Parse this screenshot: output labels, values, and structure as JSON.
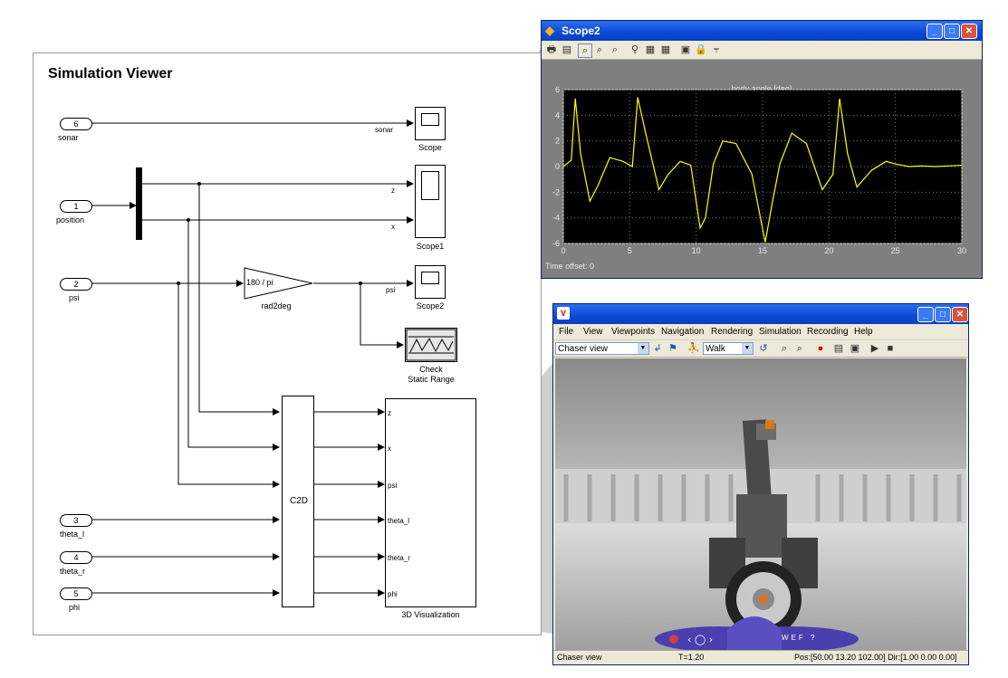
{
  "diagram": {
    "title": "Simulation Viewer",
    "inports": [
      {
        "num": "6",
        "name": "sonar"
      },
      {
        "num": "1",
        "name": "position"
      },
      {
        "num": "2",
        "name": "psi"
      },
      {
        "num": "3",
        "name": "theta_l"
      },
      {
        "num": "4",
        "name": "theta_r"
      },
      {
        "num": "5",
        "name": "phi"
      }
    ],
    "signals": {
      "sonar": "sonar",
      "z": "z",
      "x": "x",
      "psi": "psi"
    },
    "blocks": {
      "scope": "Scope",
      "scope1": "Scope1",
      "scope2": "Scope2",
      "gain_expr": "180 / pi",
      "gain_name": "rad2deg",
      "check_line1": "Check",
      "check_line2": "Static Range",
      "c2d": "C2D",
      "viz_name": "3D Visualization",
      "viz_ports": [
        "z",
        "x",
        "psi",
        "theta_l",
        "theta_r",
        "phi"
      ]
    }
  },
  "scope_window": {
    "title": "Scope2",
    "plot_title": "body angle [deg]",
    "time_offset": "Time offset:  0",
    "colors": {
      "trace": "#ffff00",
      "axes_bg": "#000000",
      "figure_bg": "#7f7f7f"
    },
    "chart_data": {
      "type": "line",
      "title": "body angle [deg]",
      "xlim": [
        0,
        30
      ],
      "ylim": [
        -6,
        6
      ],
      "xticks": [
        "0",
        "5",
        "10",
        "15",
        "20",
        "25",
        "30"
      ],
      "yticks": [
        "6",
        "4",
        "2",
        "0",
        "-2",
        "-4",
        "-6"
      ],
      "grid": true,
      "series": [
        {
          "x": [
            0,
            0.6,
            0.9,
            1.3,
            2.0,
            2.6,
            3.5,
            4.5,
            5.2,
            5.6,
            6.2,
            7.2,
            7.9,
            8.8,
            9.6,
            10.3,
            10.7,
            11.3,
            12.0,
            13.0,
            14.2,
            15.2,
            15.7,
            16.3,
            17.2,
            18.3,
            19.5,
            20.3,
            20.8,
            21.4,
            22.1,
            23.2,
            24.3,
            25.0,
            26.0,
            27.0,
            28.0,
            29.0,
            30.0
          ],
          "y": [
            0,
            0.5,
            5.3,
            1.0,
            -2.7,
            -1.5,
            0.7,
            0.4,
            0.0,
            5.4,
            2.6,
            -1.8,
            -0.6,
            0.4,
            0.1,
            -4.8,
            -4.0,
            0.2,
            2.0,
            1.8,
            -0.6,
            -5.9,
            -3.0,
            0.2,
            2.6,
            1.8,
            -1.8,
            -0.6,
            5.3,
            1.0,
            -1.6,
            -0.3,
            0.4,
            0.2,
            0.0,
            0.05,
            0.0,
            0.05,
            0.1
          ]
        }
      ]
    }
  },
  "vr_window": {
    "menu": [
      "File",
      "View",
      "Viewpoints",
      "Navigation",
      "Rendering",
      "Simulation",
      "Recording",
      "Help"
    ],
    "viewpoint": "Chaser view",
    "nav_mode": "Walk",
    "status": {
      "view": "Chaser view",
      "time": "T=1.20",
      "pos": "Pos:[50.00 13.20 102.00]  Dir:[1.00 0.00 0.00]"
    },
    "nav_buttons": [
      "W",
      "E",
      "F",
      "?"
    ]
  }
}
